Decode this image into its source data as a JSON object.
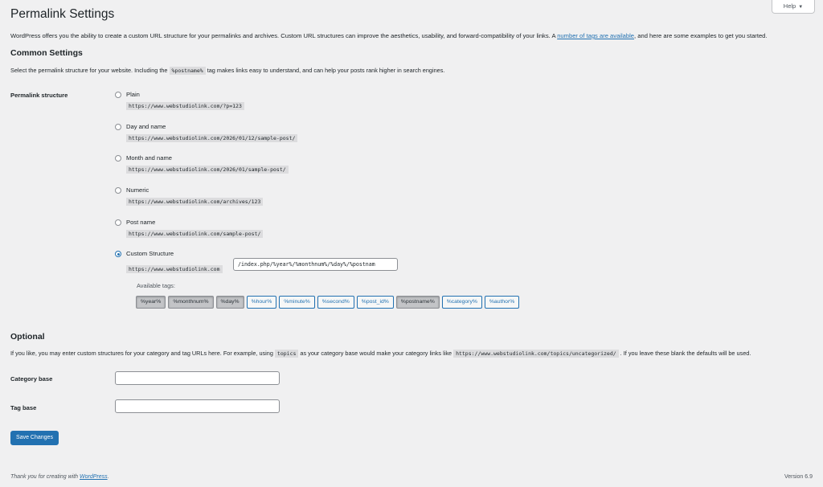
{
  "page": {
    "title": "Permalink Settings",
    "help_label": "Help",
    "intro_pre": "WordPress offers you the ability to create a custom URL structure for your permalinks and archives. Custom URL structures can improve the aesthetics, usability, and forward-compatibility of your links. A ",
    "intro_link": "number of tags are available",
    "intro_post": ", and here are some examples to get you started."
  },
  "common": {
    "heading": "Common Settings",
    "desc_pre": "Select the permalink structure for your website. Including the ",
    "desc_code": "%postname%",
    "desc_post": " tag makes links easy to understand, and can help your posts rank higher in search engines.",
    "row_label": "Permalink structure",
    "options": [
      {
        "label": "Plain",
        "url": "https://www.webstudiolink.com/?p=123",
        "checked": false
      },
      {
        "label": "Day and name",
        "url": "https://www.webstudiolink.com/2026/01/12/sample-post/",
        "checked": false
      },
      {
        "label": "Month and name",
        "url": "https://www.webstudiolink.com/2026/01/sample-post/",
        "checked": false
      },
      {
        "label": "Numeric",
        "url": "https://www.webstudiolink.com/archives/123",
        "checked": false
      },
      {
        "label": "Post name",
        "url": "https://www.webstudiolink.com/sample-post/",
        "checked": false
      },
      {
        "label": "Custom Structure",
        "url": "https://www.webstudiolink.com",
        "checked": true
      }
    ],
    "custom_value": "/index.php/%year%/%monthnum%/%day%/%postnam",
    "available_tags_label": "Available tags:",
    "tags": [
      {
        "label": "%year%",
        "active": true
      },
      {
        "label": "%monthnum%",
        "active": true
      },
      {
        "label": "%day%",
        "active": true
      },
      {
        "label": "%hour%",
        "active": false
      },
      {
        "label": "%minute%",
        "active": false
      },
      {
        "label": "%second%",
        "active": false
      },
      {
        "label": "%post_id%",
        "active": false
      },
      {
        "label": "%postname%",
        "active": true
      },
      {
        "label": "%category%",
        "active": false
      },
      {
        "label": "%author%",
        "active": false
      }
    ]
  },
  "optional": {
    "heading": "Optional",
    "desc_pre": "If you like, you may enter custom structures for your category and tag URLs here. For example, using ",
    "desc_code1": "topics",
    "desc_mid": " as your category base would make your category links like ",
    "desc_code2": "https://www.webstudiolink.com/topics/uncategorized/",
    "desc_post": " . If you leave these blank the defaults will be used.",
    "category_label": "Category base",
    "category_value": "",
    "tag_label": "Tag base",
    "tag_value": ""
  },
  "actions": {
    "save_label": "Save Changes"
  },
  "footer": {
    "left_pre": "Thank you for creating with ",
    "left_link": "WordPress",
    "left_post": ".",
    "version": "Version 6.9"
  },
  "colors": {
    "accent": "#2271b1",
    "background": "#f0f0f1",
    "text": "#1d2327"
  }
}
